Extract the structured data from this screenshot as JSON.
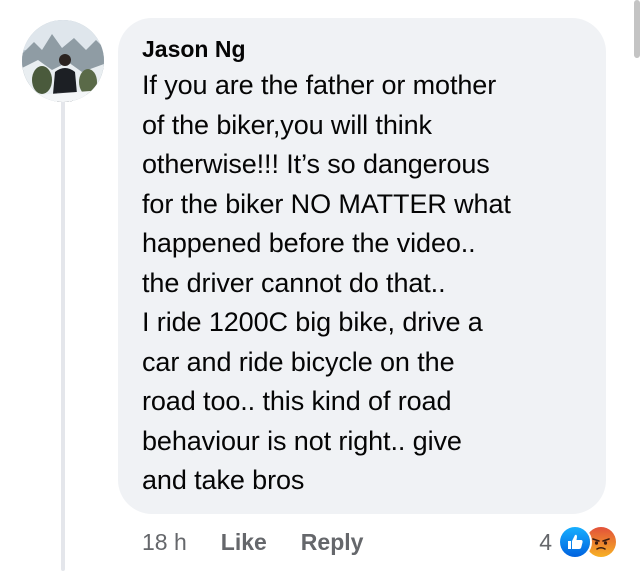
{
  "comment": {
    "author": "Jason Ng",
    "lines": [
      "If you are the father or mother",
      "of the biker,you will think",
      "otherwise!!! It’s so dangerous",
      "for the biker NO MATTER what",
      "happened before the video..",
      "the driver cannot do that..",
      "I ride 1200C big bike, drive a",
      "car and ride bicycle on the",
      "road too.. this kind of road",
      "behaviour is not right.. give",
      "and take bros"
    ]
  },
  "actions": {
    "time": "18 h",
    "like_label": "Like",
    "reply_label": "Reply"
  },
  "reactions": {
    "count": "4",
    "types": [
      "like-icon",
      "angry-icon"
    ]
  },
  "colors": {
    "bubble": "#f0f2f5",
    "text": "#050505",
    "secondary": "#65676b",
    "like_blue": "#1877f2",
    "angry_top": "#e2513a",
    "angry_bottom": "#f7b125"
  }
}
